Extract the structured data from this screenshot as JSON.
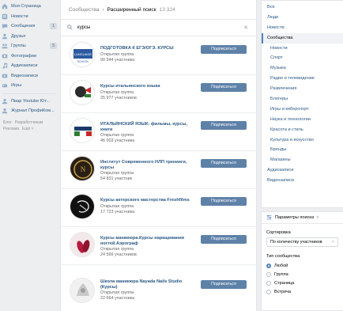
{
  "leftnav": {
    "items": [
      {
        "label": "Моя Страница",
        "icon": "home-icon"
      },
      {
        "label": "Новости",
        "icon": "news-icon"
      },
      {
        "label": "Сообщения",
        "icon": "messages-icon",
        "badge": "1"
      },
      {
        "label": "Друзья",
        "icon": "friends-icon"
      },
      {
        "label": "Группы",
        "icon": "groups-icon",
        "badge": "5"
      },
      {
        "label": "Фотографии",
        "icon": "photo-icon"
      },
      {
        "label": "Аудиозаписи",
        "icon": "music-icon"
      },
      {
        "label": "Видеозаписи",
        "icon": "video-icon"
      },
      {
        "label": "Игры",
        "icon": "games-icon"
      }
    ],
    "apps": [
      {
        "label": "Пиар Youtube Ют..."
      },
      {
        "label": "Журнал ПрофиКом..."
      }
    ],
    "footer": {
      "blog": "Блог",
      "dev": "Разработчикам",
      "ads": "Реклама",
      "more": "Ещё ˅"
    }
  },
  "main": {
    "breadcrumb": {
      "parent": "Сообщества",
      "current": "Расширенный поиск",
      "count": "13 324"
    },
    "search": {
      "value": "курсы",
      "placeholder": "Поиск сообществ"
    },
    "subscribe_label": "Подписаться",
    "results": [
      {
        "title": "ПОДГОТОВКА К ЕГЭ/ОГЭ. КУРСЫ",
        "type": "Открытая группа",
        "members": "90 544 участника"
      },
      {
        "title": "Курсы итальянского языка",
        "type": "Открытая группа",
        "members": "25 977 участников"
      },
      {
        "title": "ИТАЛЬЯНСКИЙ ЯЗЫК: фильмы, курсы, книги",
        "type": "Открытая группа",
        "members": "46 003 участника"
      },
      {
        "title": "Институт Современного НЛП тренинги, курсы",
        "type": "Открытая группа",
        "members": "54 831 участник"
      },
      {
        "title": "Курсы актерского мастерства Freshfilms",
        "type": "Открытая группа",
        "members": "17 723 участника"
      },
      {
        "title": "Курсы маникюра.Курсы наращивания ногтей.Аэрограф",
        "type": "Открытая группа",
        "members": "24 599 участников"
      },
      {
        "title": "Школа маникюра Nayada Nails Studio (Курсы)",
        "type": "Открытая группа",
        "members": "22 664 участника"
      }
    ]
  },
  "categories": {
    "top": [
      "Все",
      "Люди",
      "Новости"
    ],
    "active": "Сообщества",
    "subs": [
      "Новости",
      "Спорт",
      "Музыка",
      "Радио и телевидение",
      "Развлечения",
      "Блогеры",
      "Игры и киберспорт",
      "Наука и технологии",
      "Красота и стиль",
      "Культура и искусство",
      "Бренды",
      "Магазины"
    ],
    "bottom": [
      "Аудиозаписи",
      "Видеозаписи"
    ]
  },
  "filters": {
    "header": "Параметры поиска",
    "sort_label": "Сортировка",
    "sort_value": "По количеству участников",
    "type_label": "Тип сообщества",
    "types": [
      "Любой",
      "Группа",
      "Страница",
      "Встреча"
    ],
    "selected_type": "Любой"
  },
  "colors": {
    "accent": "#5181b8",
    "button": "#5e81a8",
    "link": "#2a5885",
    "background": "#edeef0"
  }
}
